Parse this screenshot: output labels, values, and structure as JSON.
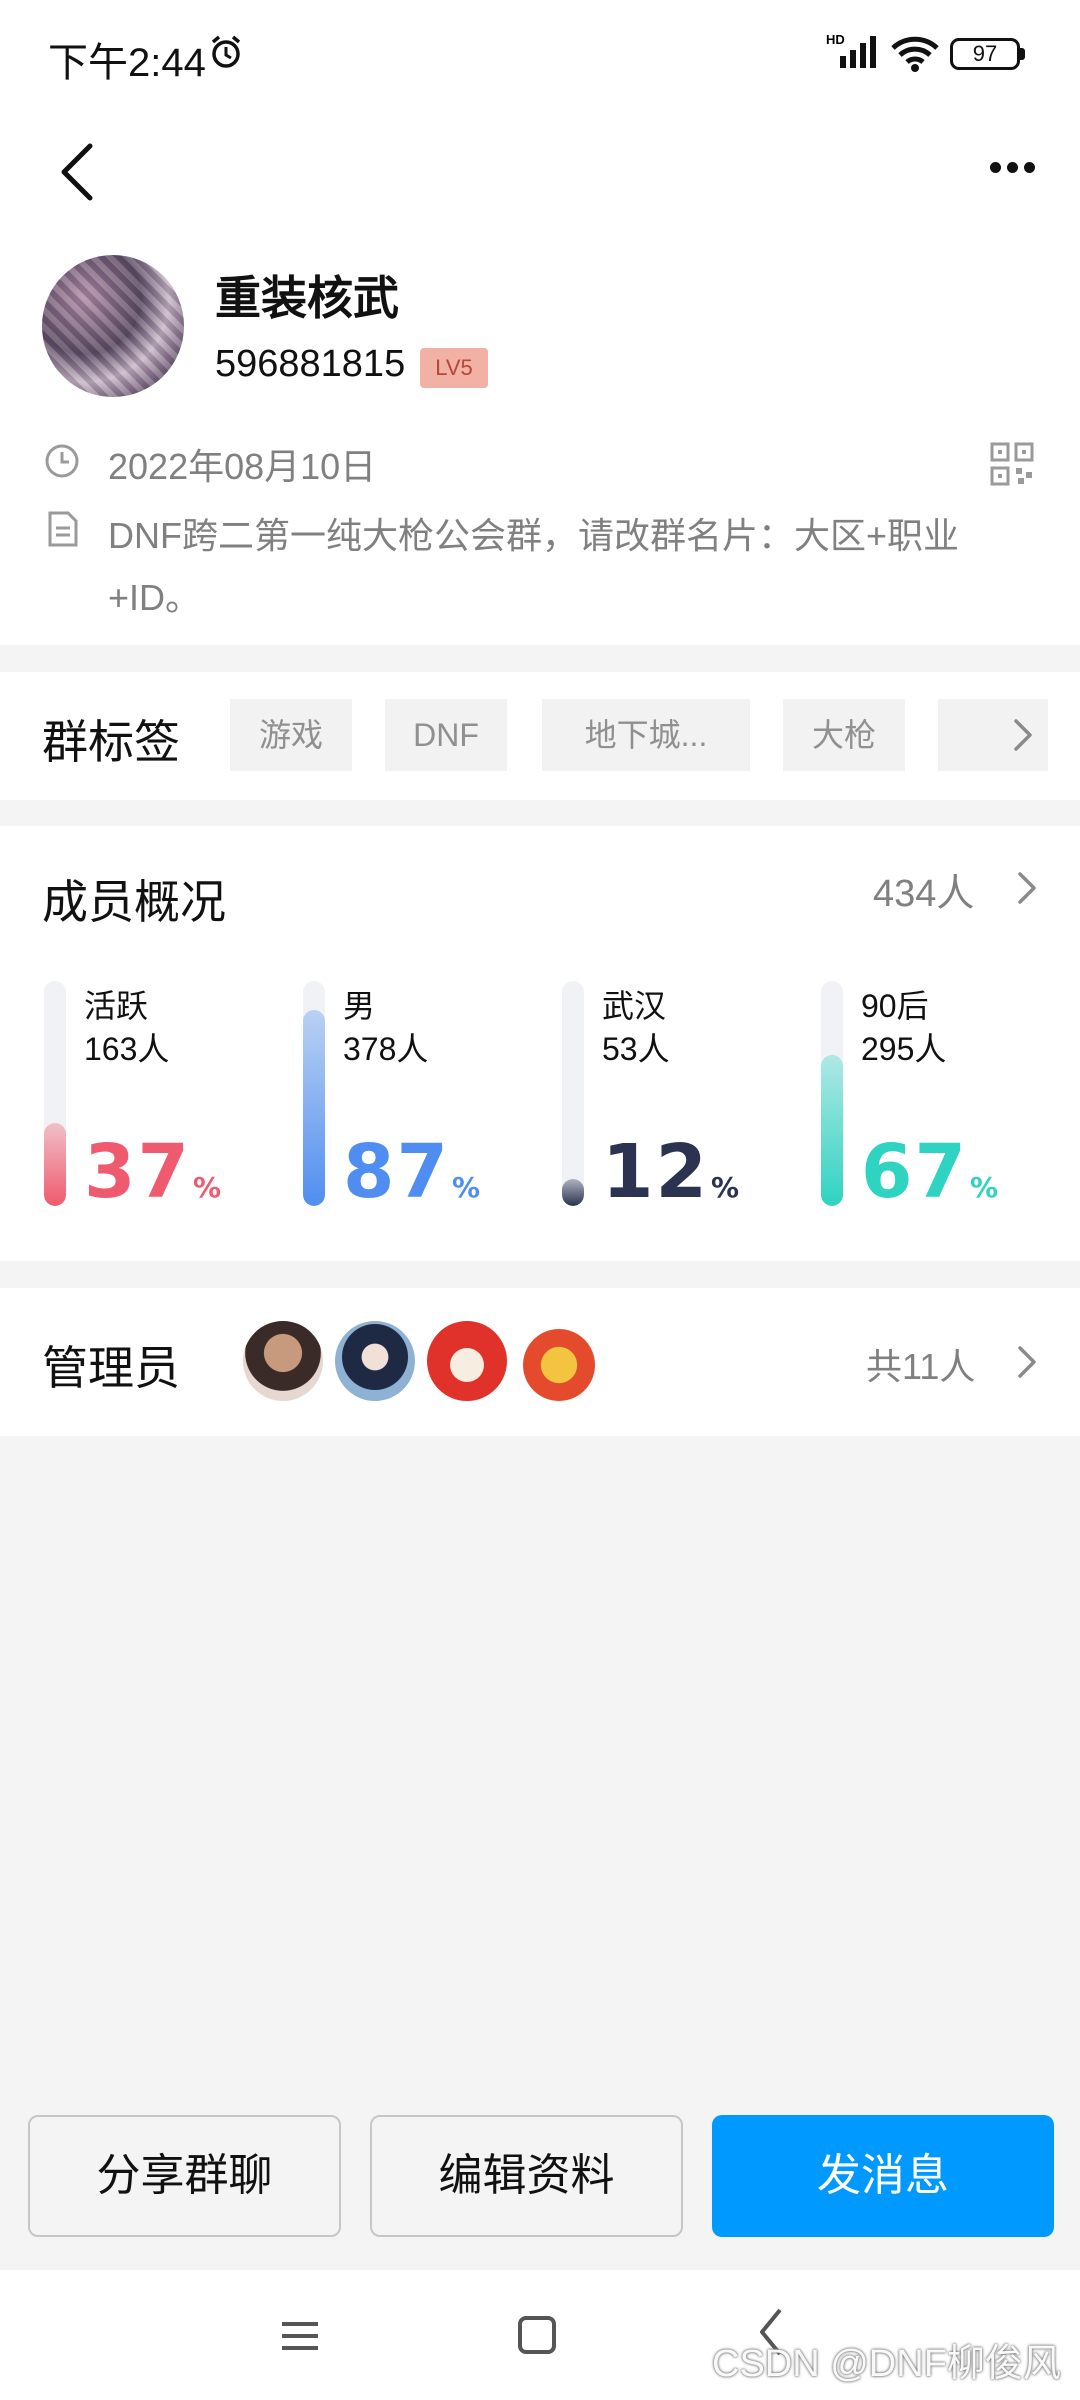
{
  "status_bar": {
    "time": "下午2:44",
    "network_label": "HD",
    "battery": "97"
  },
  "header": {
    "group_name": "重装核武",
    "group_id": "596881815",
    "level_badge": "LV5",
    "created_date": "2022年08月10日",
    "description": "DNF跨二第一纯大枪公会群，请改群名片：大区+职业+ID。"
  },
  "tags": {
    "title": "群标签",
    "items": [
      "游戏",
      "DNF",
      "地下城...",
      "大枪"
    ]
  },
  "members": {
    "title": "成员概况",
    "count": "434人",
    "stats": [
      {
        "label": "活跃",
        "count": "163人",
        "percent": "37",
        "unit": "%",
        "fraction": 0.37,
        "color": "#f05a6e"
      },
      {
        "label": "男",
        "count": "378人",
        "percent": "87",
        "unit": "%",
        "fraction": 0.87,
        "color": "#4f8ef0"
      },
      {
        "label": "武汉",
        "count": "53人",
        "percent": "12",
        "unit": "%",
        "fraction": 0.12,
        "color": "#2c3350"
      },
      {
        "label": "90后",
        "count": "295人",
        "percent": "67",
        "unit": "%",
        "fraction": 0.67,
        "color": "#2ed3c2"
      }
    ]
  },
  "admins": {
    "title": "管理员",
    "count": "共11人"
  },
  "actions": {
    "share": "分享群聊",
    "edit": "编辑资料",
    "send": "发消息"
  },
  "watermark": "CSDN @DNF柳俊风"
}
